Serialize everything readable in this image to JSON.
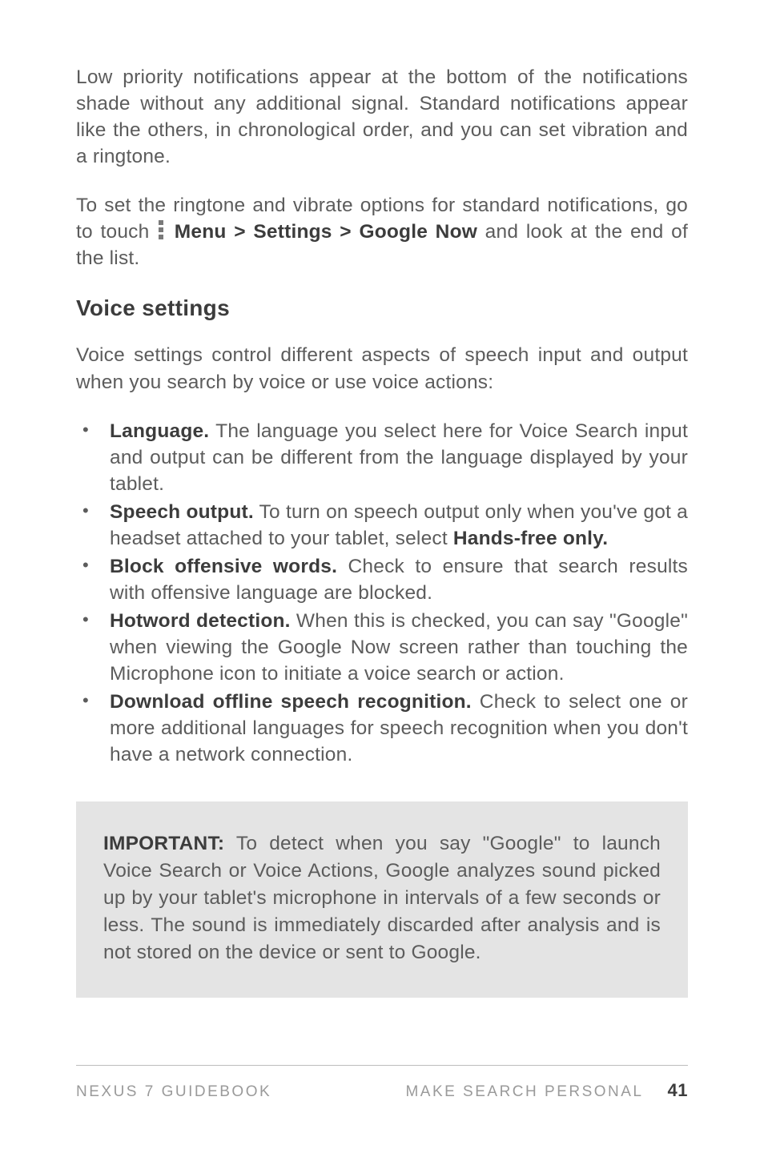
{
  "paragraphs": {
    "p1": "Low priority notifications appear at the bottom of the notifica­tions shade without any additional signal. Standard notifications appear like the others, in chronological order, and you can set vi­bration and a ringtone.",
    "p2_part1": "To set the ringtone and vibrate options for standard notifications, go to touch ",
    "p2_bold": "Menu > Settings > Google Now",
    "p2_part2": " and look at the end of the list.",
    "voice_intro": "Voice settings control different aspects of speech input and out­put when you search by voice or use voice actions:"
  },
  "heading": "Voice settings",
  "bullets": [
    {
      "term": "Language.",
      "desc": " The language you select here for Voice Search in­put and output can be different from the language displayed by your tablet."
    },
    {
      "term": "Speech output.",
      "desc_1": " To turn on speech output only when you've got a headset attached to your tablet, select ",
      "bold2": "Hands-free only."
    },
    {
      "term": "Block offensive words.",
      "desc": " Check to ensure that search results with offensive language are blocked."
    },
    {
      "term": "Hotword detection.",
      "desc": " When this is checked, you can say \"Google\" when viewing the Google Now screen rather than touching the Microphone icon to initiate a voice search or action."
    },
    {
      "term": "Download offline speech recognition.",
      "desc": " Check to select one or more additional languages for speech recognition when you don't have a network connection."
    }
  ],
  "callout": {
    "label": "IMPORTANT:",
    "text": " To detect when you say \"Google\" to launch Voice Search or Voice Actions, Google analyzes sound picked up by your tablet's microphone in intervals of a few seconds or less. The sound is immediately discarded after analysis and is not stored on the device or sent to Google."
  },
  "footer": {
    "book": "NEXUS 7 GUIDEBOOK",
    "section": "MAKE SEARCH PERSONAL",
    "page": "41"
  }
}
